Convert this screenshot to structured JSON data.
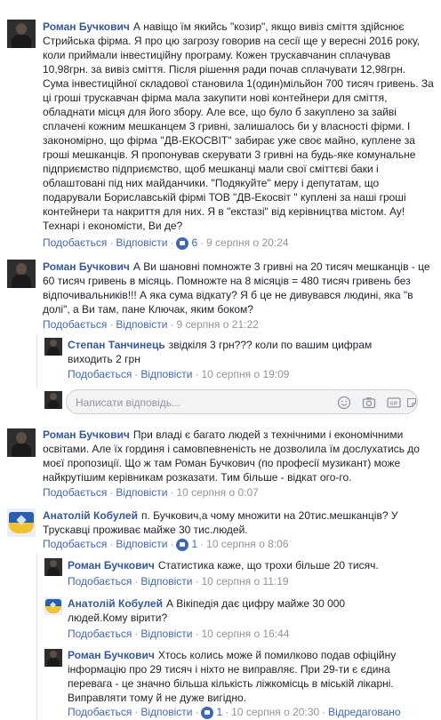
{
  "actions": {
    "like": "Подобається",
    "reply": "Відповісти",
    "dot": "·"
  },
  "reply_box": {
    "placeholder": "Написати відповідь..."
  },
  "comments": [
    {
      "author": "Роман Бучкович",
      "text": "А навіщо їм якийсь \"козир\", якщо вивіз сміття здійснює Стрийська фірма. Я про цю загрозу говорив на сесії ще у вересні 2016 року, коли приймали інвестиційну програму. Кожен трускавчанин сплачував 10,98грн. за вивіз сміття. Після рішення ради почав сплачувати 12,98грн. Сума інвестиційної складової становила 1(один)мільйон 700 тисяч гривень. За ці гроші трускавчан фірма мала закупити нові контейнери для сміття, обладнати місця для його збору. Але все, що було б закуплено за зайві сплачені кожним мешканцем 3 гривні, залишалось би у власності фірми. І закономірно, що фірма \"ДВ-ЕКОСВІТ\" забирає уже своє майно, куплене за гроші мешканців. Я пропонував скерувати 3 гривні на будь-яке комунальне підприємство підприємство, щоб мешканці мали свої сміттєві баки і облаштовані під них майданчики. \"Подякуйте\" меру і депутатам, що подарували Бориславській фірмі ТОВ \"ДВ-Екосвіт \" куплені за наші гроші контейнери та накриття для них. Я в \"екстазі\" від керівництва містом. Ау! Технарі і економісти, Ви де?",
      "reactions": "6",
      "time": "9 серпня о 20:24"
    },
    {
      "author": "Роман Бучкович",
      "text": "А Ви шановні помножте 3 гривні на 20 тисяч мешканців - це 60 тисяч гривень в місяць. Помножте на 8 місяців = 480 тисяч гривень без відпочивальників!!! А яка сума відкату? Я б це не дивувався людині, яка \"в долі\", а Ви там, пане Ключак, яким боком?",
      "time": "9 серпня о 21:22"
    },
    {
      "author": "Степан Танчинець",
      "text": "звідкіля 3 грн??? коли по вашим цифрам виходить 2 грн",
      "time": "10 серпня о 19:09"
    },
    {
      "author": "Роман Бучкович",
      "text": "При владі є багато людей з технічними і економічними освітами. Але їх гординя і самовпевненість не дозволила їм дослухатись до моєї пропозиції. Що ж там Роман Бучкович (по професії музикант) може найкрутішим керівникам розказати. Тим більше - відкат ого-го.",
      "time": "10 серпня о 0:07"
    },
    {
      "author": "Анатолій Кобулей",
      "text": "п. Бучкович,а чому множити на 20тис.мешканців? У Трускавці проживає майже 30 тис.людей.",
      "reactions": "1",
      "time": "10 серпня о 8:06"
    },
    {
      "author": "Роман Бучкович",
      "text": "Статистика каже, що трохи більше 20 тисяч.",
      "time": "10 серпня о 11:19"
    },
    {
      "author": "Анатолій Кобулей",
      "text": "А Вікіпедія дає цифру майже 30 000 людей.Кому вірити?",
      "time": "10 серпня о 16:44"
    },
    {
      "author": "Роман Бучкович",
      "text": "Хтось колись може й помилково подав офіційну інформацію про 29 тисяч і ніхто не виправляє. При 29-ти є єдина перевага - це значно більша кількість ліжкомісць в міській лікарні. Виправляти тому й не дуже вигідно.",
      "reactions": "1",
      "time": "10 серпня о 20:30",
      "edited": "Відредаговано"
    }
  ]
}
